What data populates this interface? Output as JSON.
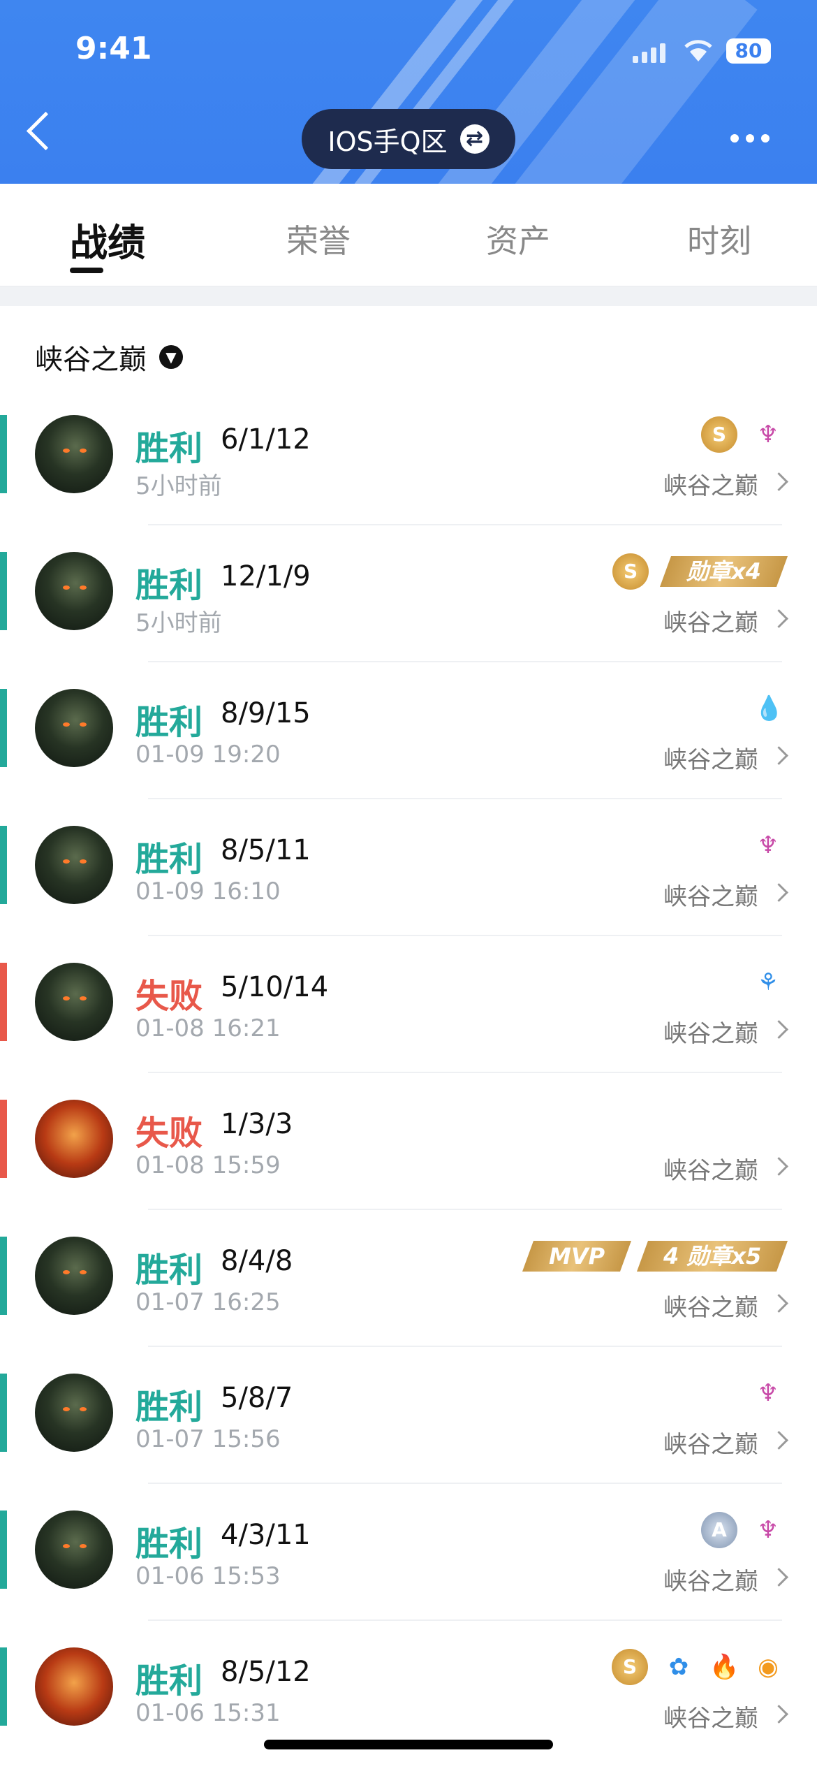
{
  "status": {
    "time": "9:41",
    "battery": "80"
  },
  "header": {
    "server": "IOS手Q区",
    "swap_icon": "⇄"
  },
  "tabs": [
    "战绩",
    "荣誉",
    "资产",
    "时刻"
  ],
  "mode_filter": "峡谷之巅",
  "matches": [
    {
      "result": "胜利",
      "kda": "6/1/12",
      "when": "5小时前",
      "mode": "峡谷之巅",
      "badges": [
        "gold-s-medal-icon",
        "purple-demon-icon"
      ]
    },
    {
      "result": "胜利",
      "kda": "12/1/9",
      "when": "5小时前",
      "mode": "峡谷之巅",
      "badges": [
        "gold-s-medal-icon"
      ],
      "strip": "勋章x4"
    },
    {
      "result": "胜利",
      "kda": "8/9/15",
      "when": "01-09 19:20",
      "mode": "峡谷之巅",
      "badges": [
        "red-drop-icon"
      ]
    },
    {
      "result": "胜利",
      "kda": "8/5/11",
      "when": "01-09 16:10",
      "mode": "峡谷之巅",
      "badges": [
        "purple-demon-icon"
      ]
    },
    {
      "result": "失败",
      "kda": "5/10/14",
      "when": "01-08 16:21",
      "mode": "峡谷之巅",
      "badges": [
        "blue-tree-icon"
      ]
    },
    {
      "result": "失败",
      "kda": "1/3/3",
      "when": "01-08 15:59",
      "mode": "峡谷之巅",
      "badges": []
    },
    {
      "result": "胜利",
      "kda": "8/4/8",
      "when": "01-07 16:25",
      "mode": "峡谷之巅",
      "badges": [],
      "mvp": "MVP",
      "strip": "4 勋章x5"
    },
    {
      "result": "胜利",
      "kda": "5/8/7",
      "when": "01-07 15:56",
      "mode": "峡谷之巅",
      "badges": [
        "purple-demon-icon"
      ]
    },
    {
      "result": "胜利",
      "kda": "4/3/11",
      "when": "01-06 15:53",
      "mode": "峡谷之巅",
      "badges": [
        "silver-a-medal-icon",
        "purple-demon-icon"
      ]
    },
    {
      "result": "胜利",
      "kda": "8/5/12",
      "when": "01-06 15:31",
      "mode": "峡谷之巅",
      "badges": [
        "gold-s-medal-icon",
        "blue-flame-icon",
        "orange-flame-icon",
        "orange-coins-icon"
      ]
    }
  ],
  "colors": {
    "header_blue": "#3b80ef",
    "win": "#23a99a",
    "loss": "#e8584a"
  }
}
